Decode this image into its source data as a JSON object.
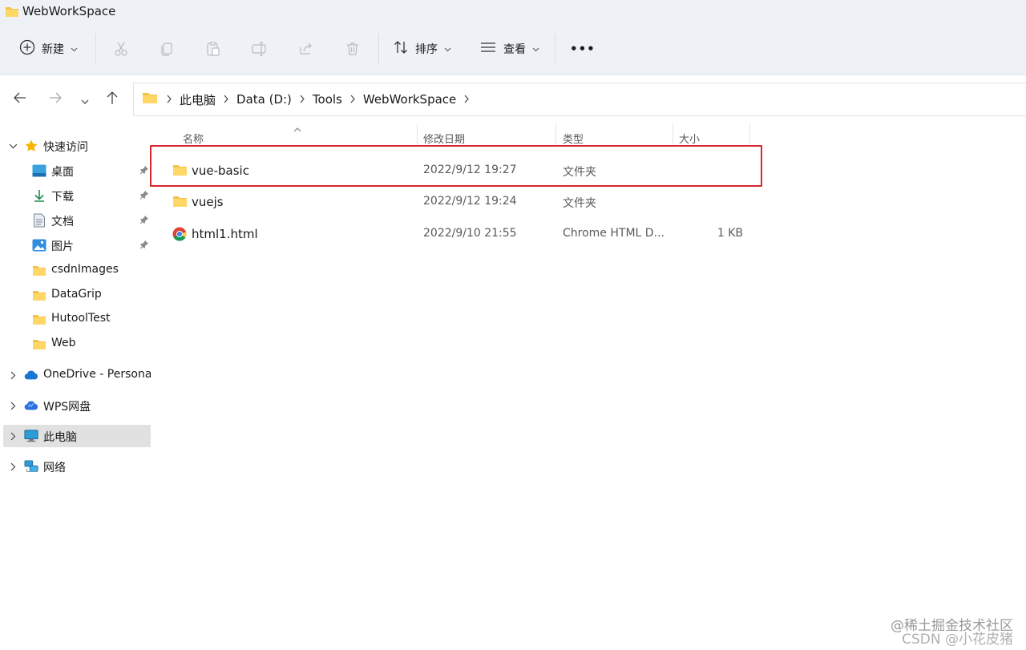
{
  "window": {
    "title": "WebWorkSpace"
  },
  "toolbar": {
    "new_label": "新建",
    "sort_label": "排序",
    "view_label": "查看",
    "more_label": "•••"
  },
  "address": {
    "crumbs": [
      "此电脑",
      "Data (D:)",
      "Tools",
      "WebWorkSpace"
    ]
  },
  "sidebar": {
    "quick_access": "快速访问",
    "items": [
      {
        "label": "桌面",
        "icon": "desktop-icon",
        "pinned": true
      },
      {
        "label": "下载",
        "icon": "download-icon",
        "pinned": true
      },
      {
        "label": "文档",
        "icon": "document-icon",
        "pinned": true
      },
      {
        "label": "图片",
        "icon": "pictures-icon",
        "pinned": true
      },
      {
        "label": "csdnImages",
        "icon": "folder-icon",
        "pinned": false
      },
      {
        "label": "DataGrip",
        "icon": "folder-icon",
        "pinned": false
      },
      {
        "label": "HutoolTest",
        "icon": "folder-icon",
        "pinned": false
      },
      {
        "label": "Web",
        "icon": "folder-icon",
        "pinned": false
      }
    ],
    "onedrive": "OneDrive - Persona",
    "wps": "WPS网盘",
    "this_pc": "此电脑",
    "network": "网络"
  },
  "columns": {
    "name": "名称",
    "modified": "修改日期",
    "type": "类型",
    "size": "大小"
  },
  "files": [
    {
      "name": "vue-basic",
      "modified": "2022/9/12 19:27",
      "type": "文件夹",
      "size": "",
      "icon": "folder-icon"
    },
    {
      "name": "vuejs",
      "modified": "2022/9/12 19:24",
      "type": "文件夹",
      "size": "",
      "icon": "folder-icon"
    },
    {
      "name": "html1.html",
      "modified": "2022/9/10 21:55",
      "type": "Chrome HTML D...",
      "size": "1 KB",
      "icon": "chrome-icon"
    }
  ],
  "watermark": {
    "line1": "@稀土掘金技术社区",
    "line2": "CSDN @小花皮猪"
  },
  "colors": {
    "chrome_bg": "#eef2f7",
    "folder": "#f4c14a",
    "highlight": "#d7262e",
    "selected": "#e1e1e1"
  }
}
